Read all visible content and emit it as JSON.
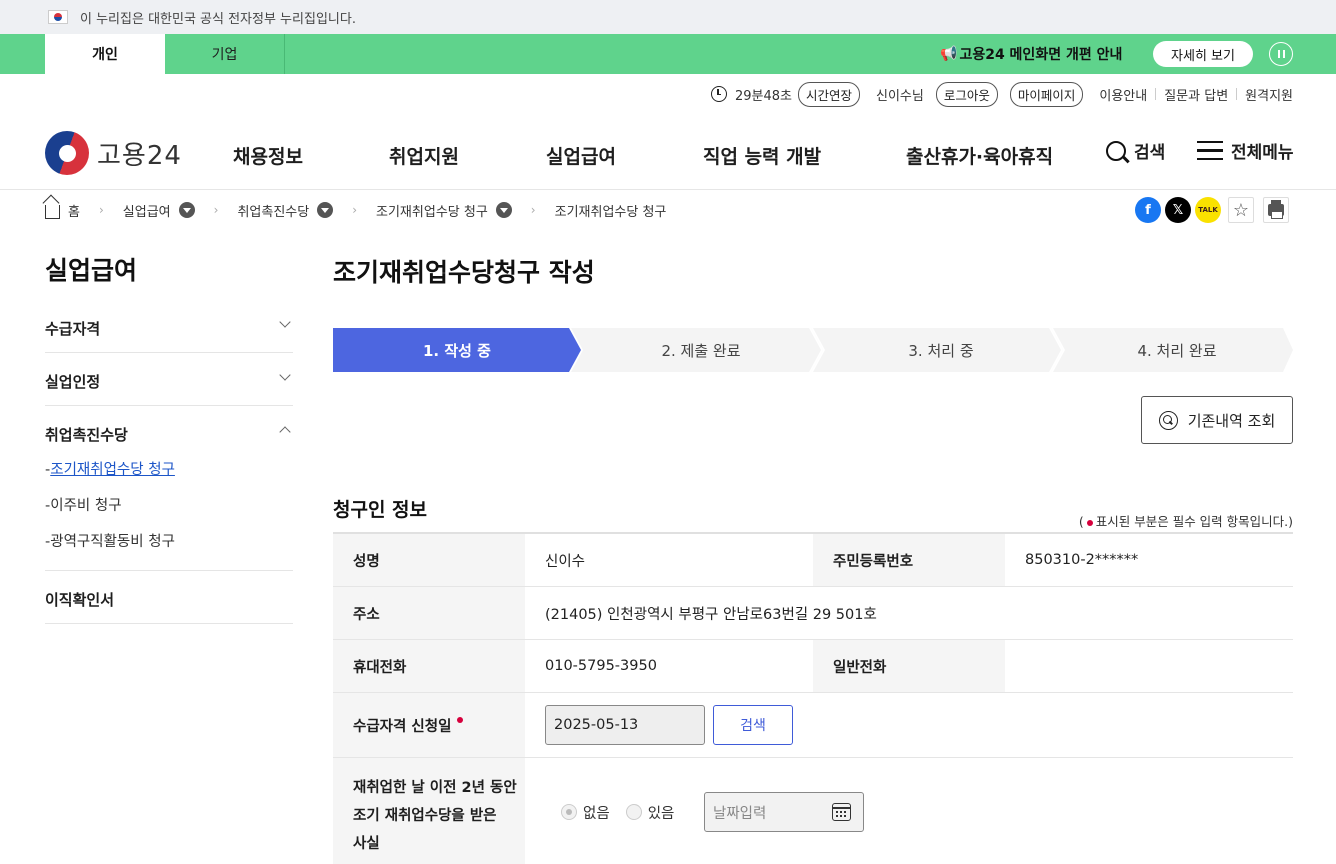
{
  "gov_banner": {
    "text": "이 누리집은 대한민국 공식 전자정부 누리집입니다."
  },
  "top_bar": {
    "tab_personal": "개인",
    "tab_corporate": "기업",
    "notice": "고용24 메인화면 개편 안내",
    "notice_icon": "megaphone-icon",
    "detail_button": "자세히 보기"
  },
  "util": {
    "timer": "29분48초",
    "extend_button": "시간연장",
    "user_name": "신이수님",
    "logout_button": "로그아웃",
    "mypage_button": "마이페이지",
    "links": [
      "이용안내",
      "질문과 답변",
      "원격지원"
    ]
  },
  "header": {
    "logo_text": "고용24",
    "nav": [
      "채용정보",
      "취업지원",
      "실업급여",
      "직업 능력 개발",
      "출산휴가·육아휴직"
    ],
    "search_label": "검색",
    "menu_label": "전체메뉴"
  },
  "breadcrumb": {
    "home": "홈",
    "items": [
      "실업급여",
      "취업촉진수당",
      "조기재취업수당 청구",
      "조기재취업수당 청구"
    ]
  },
  "share": {
    "twitter_glyph": "𝕏",
    "kakao_label": "TALK",
    "favorite_glyph": "☆"
  },
  "sidebar": {
    "title": "실업급여",
    "items": [
      "수급자격",
      "실업인정",
      "취업촉진수당",
      "이직확인서"
    ],
    "sub_items": [
      "조기재취업수당 청구",
      "이주비 청구",
      "광역구직활동비 청구"
    ],
    "sub_prefix": "-"
  },
  "main": {
    "title": "조기재취업수당청구 작성",
    "steps": [
      "1. 작성 중",
      "2. 제출 완료",
      "3. 처리 중",
      "4. 처리 완료"
    ],
    "history_button": "기존내역 조회",
    "section_title": "청구인 정보",
    "required_note_prefix": "(",
    "required_note": "표시된 부분은 필수 입력 항목입니다.)"
  },
  "form": {
    "name_label": "성명",
    "name_value": "신이수",
    "rrn_label": "주민등록번호",
    "rrn_value": "850310-2******",
    "address_label": "주소",
    "address_value": "(21405) 인천광역시 부평구 안남로63번길 29 501호",
    "mobile_label": "휴대전화",
    "mobile_value": "010-5795-3950",
    "phone_label": "일반전화",
    "phone_value": "",
    "apply_date_label": "수급자격 신청일",
    "apply_date_value": "2025-05-13",
    "search_button": "검색",
    "prior_label_lines": [
      "재취업한 날 이전 2년 동안",
      "조기 재취업수당을 받은",
      "사실"
    ],
    "radio_none": "없음",
    "radio_yes": "있음",
    "date_placeholder": "날짜입력"
  }
}
